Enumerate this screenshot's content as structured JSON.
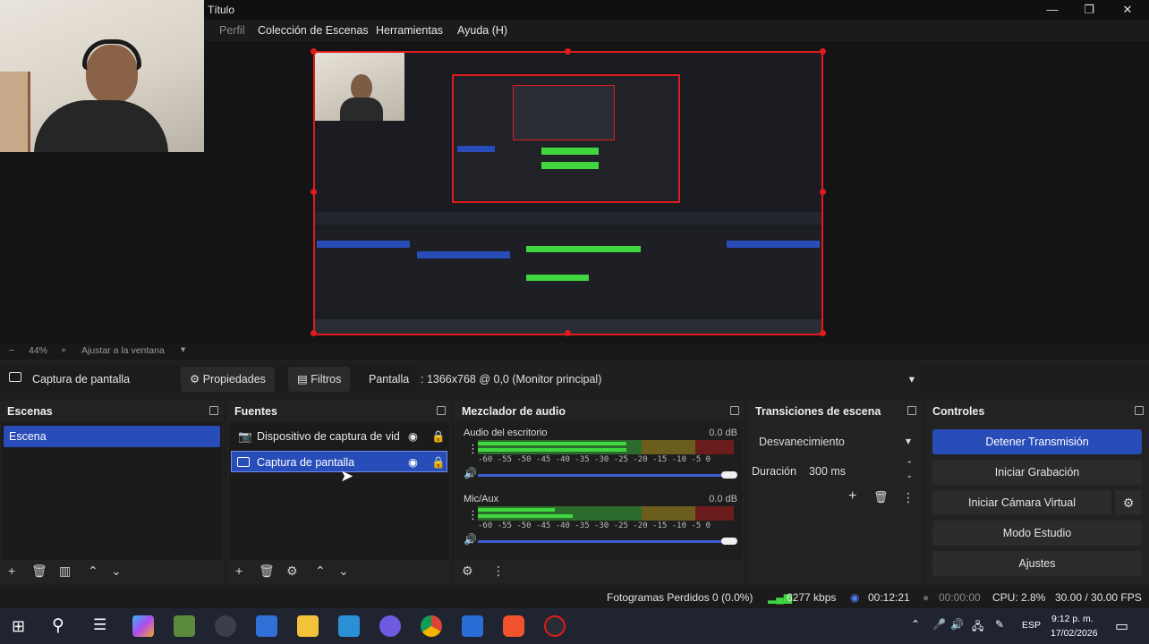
{
  "window": {
    "title": "Título",
    "minimize": "—",
    "restore": "❐",
    "close": "✕"
  },
  "menu": {
    "items": [
      "Perfil",
      "Colección de Escenas",
      "Herramientas",
      "Ayuda (H)"
    ]
  },
  "preview": {
    "zoom": "44%",
    "fit_label": "Ajustar a la ventana"
  },
  "context": {
    "source_name": "Captura de pantalla",
    "properties_label": "Propiedades",
    "filters_label": "Filtros",
    "display_label": "Pantalla",
    "display_value": ": 1366x768 @ 0,0 (Monitor principal)"
  },
  "scenes": {
    "title": "Escenas",
    "items": [
      "Escena"
    ]
  },
  "sources": {
    "title": "Fuentes",
    "items": [
      "Dispositivo de captura de vid",
      "Captura de pantalla"
    ]
  },
  "mixer": {
    "title": "Mezclador de audio",
    "channels": [
      {
        "name": "Audio del escritorio",
        "db": "0.0 dB",
        "level_top": 0.58,
        "level_bottom": 0.58
      },
      {
        "name": "Mic/Aux",
        "db": "0.0 dB",
        "level_top": 0.3,
        "level_bottom": 0.37
      }
    ],
    "ticks": "-60 -55 -50 -45 -40 -35 -30 -25 -20 -15 -10 -5 0"
  },
  "transitions": {
    "title": "Transiciones de escena",
    "selected": "Desvanecimiento",
    "duration_label": "Duración",
    "duration_value": "300 ms"
  },
  "controls": {
    "title": "Controles",
    "stop_stream": "Detener Transmisión",
    "start_recording": "Iniciar Grabación",
    "start_virtual_cam": "Iniciar Cámara Virtual",
    "studio_mode": "Modo Estudio",
    "settings": "Ajustes"
  },
  "status": {
    "dropped_frames": "Fotogramas Perdidos 0 (0.0%)",
    "bitrate": "6277 kbps",
    "stream_time": "00:12:21",
    "rec_time": "00:00:00",
    "cpu": "CPU: 2.8%",
    "fps": "30.00 / 30.00 FPS"
  },
  "taskbar": {
    "lang": "ESP",
    "time": "9:12 p. m.",
    "date": "17/02/2026"
  },
  "colors": {
    "accent": "#284cb8",
    "selection_border": "#e01b1b",
    "meter_green": "#3fd63f"
  }
}
